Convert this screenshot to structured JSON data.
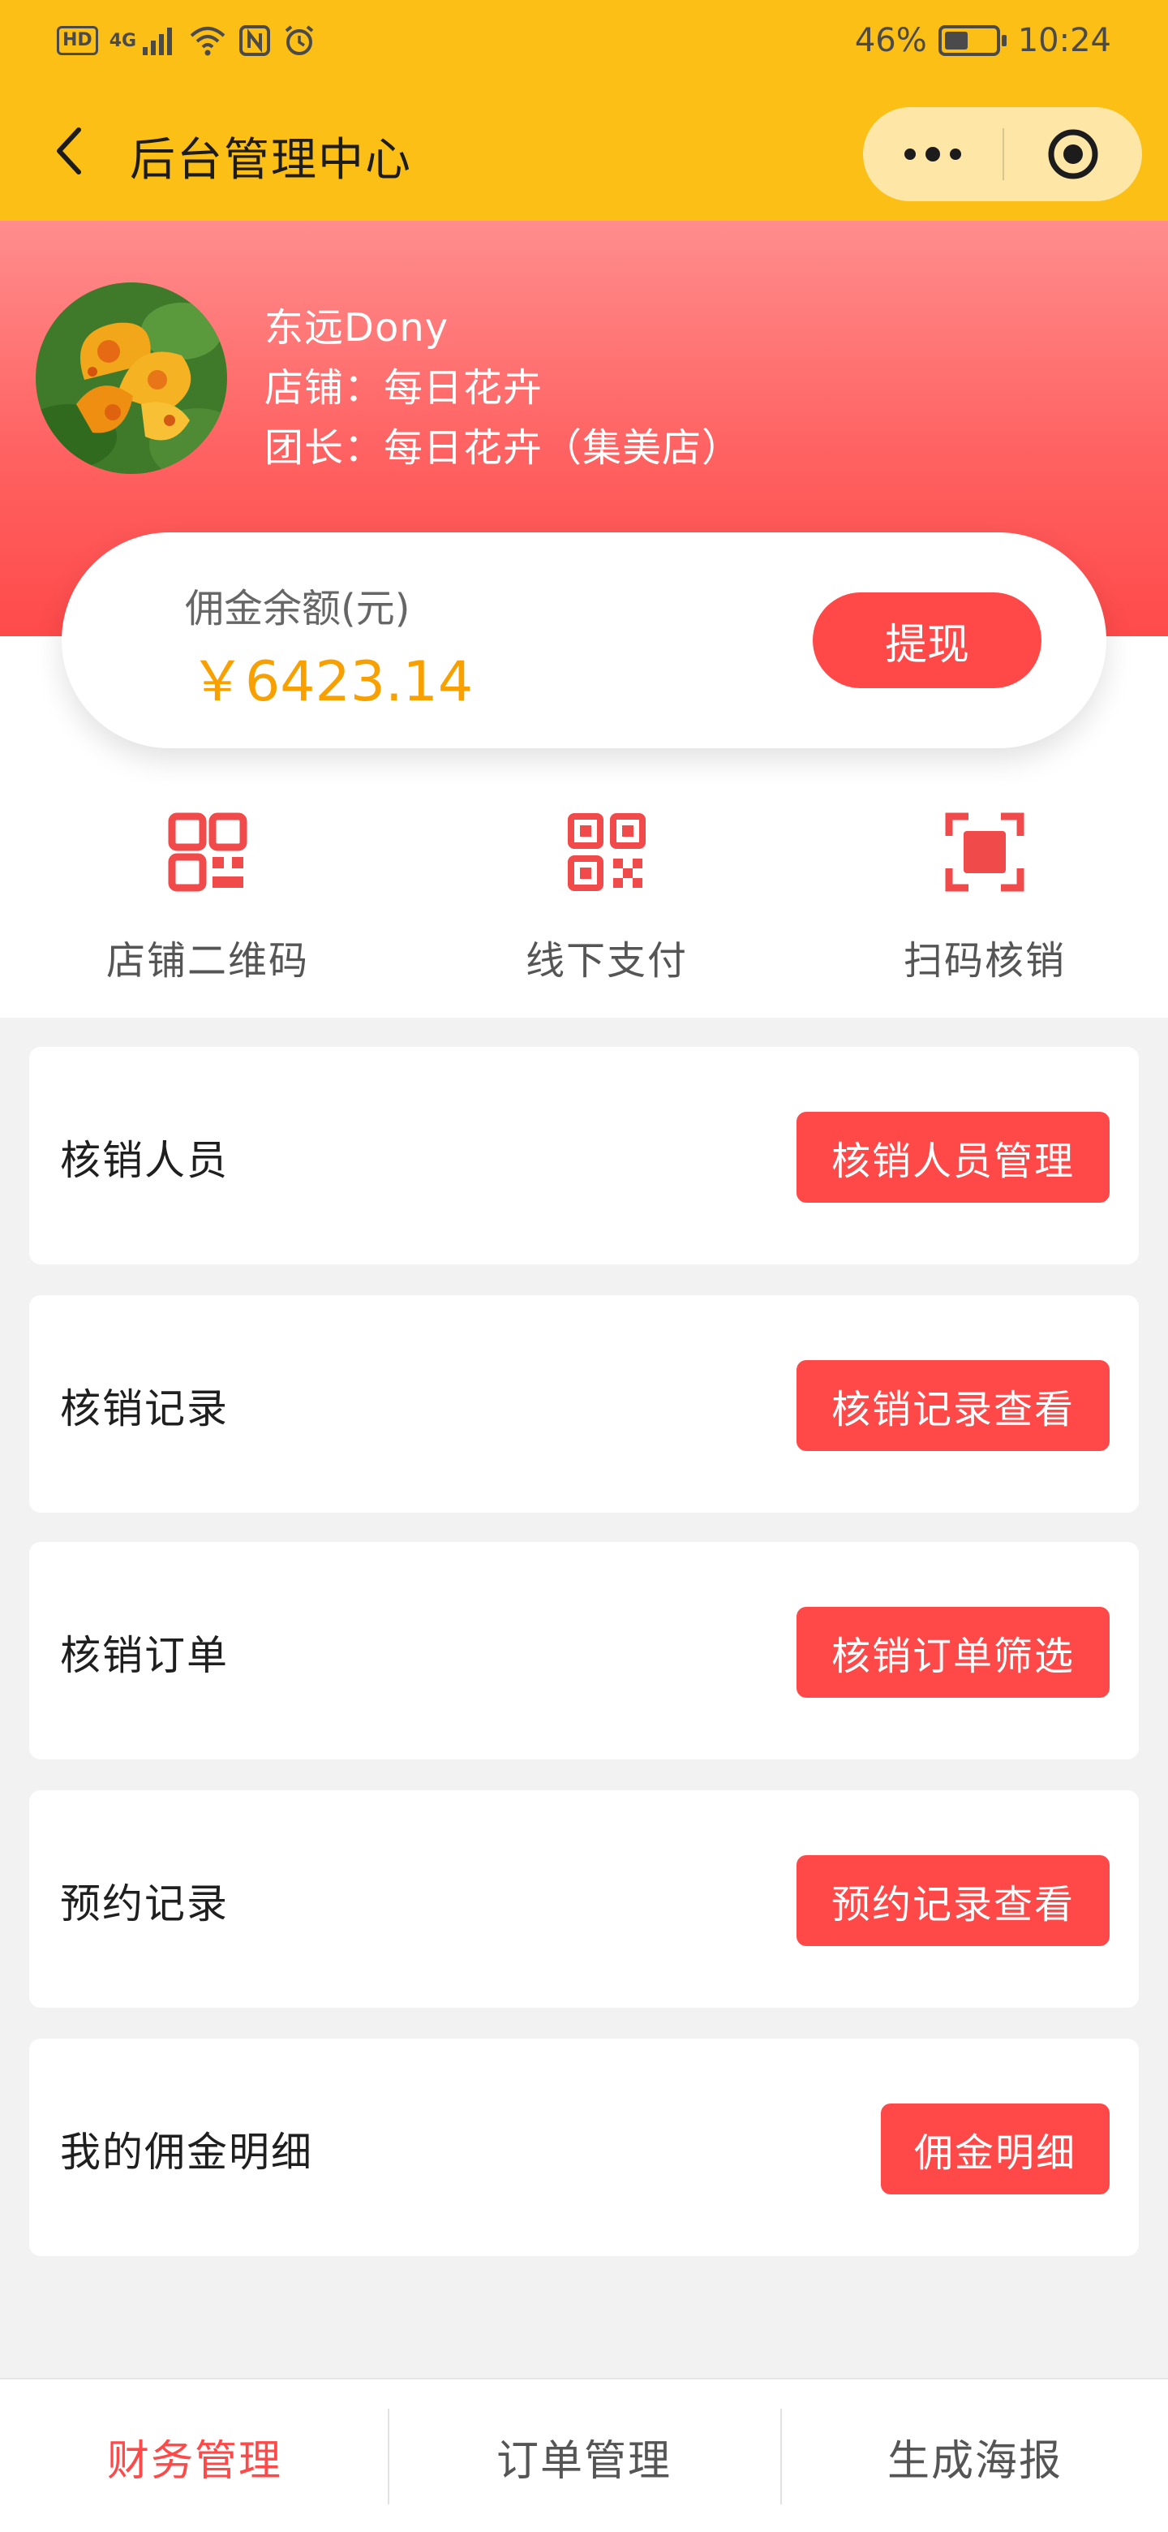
{
  "status_bar": {
    "network": "4G",
    "hd": "HD",
    "battery": "46%",
    "battery_level": 0.46,
    "time": "10:24"
  },
  "nav": {
    "title": "后台管理中心",
    "icons": [
      "back-icon",
      "more-dots-icon",
      "close-circle-icon"
    ]
  },
  "profile": {
    "name": "东远Dony",
    "shop": "店铺：每日花卉",
    "leader": "团长：每日花卉（集美店）"
  },
  "balance": {
    "label": "佣金余额(元)",
    "value": "￥6423.14",
    "withdraw_label": "提现"
  },
  "quick_actions": [
    {
      "label": "店铺二维码",
      "icon": "qrcode-icon"
    },
    {
      "label": "线下支付",
      "icon": "qrcode-pay-icon"
    },
    {
      "label": "扫码核销",
      "icon": "scan-icon"
    }
  ],
  "rows": [
    {
      "label": "核销人员",
      "button": "核销人员管理"
    },
    {
      "label": "核销记录",
      "button": "核销记录查看"
    },
    {
      "label": "核销订单",
      "button": "核销订单筛选"
    },
    {
      "label": "预约记录",
      "button": "预约记录查看"
    },
    {
      "label": "我的佣金明细",
      "button": "佣金明细"
    }
  ],
  "tabs": [
    {
      "label": "财务管理",
      "active": true
    },
    {
      "label": "订单管理",
      "active": false
    },
    {
      "label": "生成海报",
      "active": false
    }
  ],
  "colors": {
    "nav_bg": "#fbbf16",
    "accent_red": "#ff4848",
    "amount_orange": "#f7a000"
  }
}
